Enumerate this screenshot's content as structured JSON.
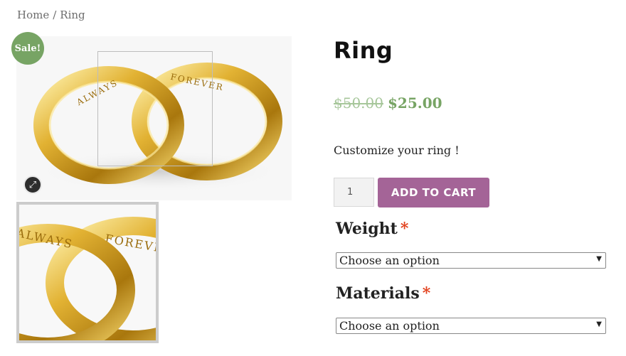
{
  "breadcrumb": {
    "home": "Home",
    "separator": "/",
    "current": "Ring"
  },
  "gallery": {
    "sale_badge": "Sale!",
    "zoom_icon": "expand-icon",
    "ring_text_left": "ALWAYS",
    "ring_text_right": "FOREVER"
  },
  "product": {
    "title": "Ring",
    "price_old": "$50.00",
    "price_new": "$25.00",
    "short_description": "Customize your ring !",
    "quantity": "1",
    "add_to_cart_label": "ADD TO CART"
  },
  "variations": {
    "weight": {
      "label": "Weight",
      "required_mark": "*",
      "selected": "Choose an option"
    },
    "materials": {
      "label": "Materials",
      "required_mark": "*",
      "selected": "Choose an option"
    }
  },
  "colors": {
    "sale": "#77a464",
    "button": "#a46497",
    "required": "#e2401c",
    "gold": "#d9a521"
  }
}
